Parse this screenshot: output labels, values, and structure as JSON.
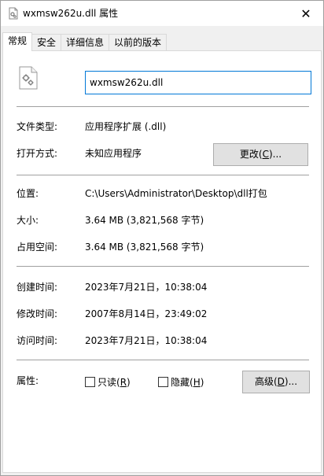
{
  "window": {
    "title": "wxmsw262u.dll 属性",
    "close_glyph": "✕"
  },
  "tabs": [
    {
      "label": "常规",
      "active": true
    },
    {
      "label": "安全",
      "active": false
    },
    {
      "label": "详细信息",
      "active": false
    },
    {
      "label": "以前的版本",
      "active": false
    }
  ],
  "file": {
    "icon": "dll-file-gear-icon",
    "name": "wxmsw262u.dll"
  },
  "general": {
    "type_label": "文件类型:",
    "type_value": "应用程序扩展 (.dll)",
    "opens_label": "打开方式:",
    "opens_value": "未知应用程序",
    "change_button": {
      "text": "更改(",
      "key": "C",
      "suffix": ")..."
    }
  },
  "location": {
    "location_label": "位置:",
    "location_value": "C:\\Users\\Administrator\\Desktop\\dll打包",
    "size_label": "大小:",
    "size_value": "3.64 MB (3,821,568 字节)",
    "disk_label": "占用空间:",
    "disk_value": "3.64 MB (3,821,568 字节)"
  },
  "times": {
    "created_label": "创建时间:",
    "created_value": "2023年7月21日，10:38:04",
    "modified_label": "修改时间:",
    "modified_value": "2007年8月14日，23:49:02",
    "accessed_label": "访问时间:",
    "accessed_value": "2023年7月21日，10:38:04"
  },
  "attributes": {
    "label": "属性:",
    "readonly": {
      "text": "只读(",
      "key": "R",
      "suffix": ")",
      "checked": false
    },
    "hidden": {
      "text": "隐藏(",
      "key": "H",
      "suffix": ")",
      "checked": false
    },
    "advanced_button": {
      "text": "高级(",
      "key": "D",
      "suffix": ")..."
    }
  },
  "colors": {
    "focus_border": "#0078d7",
    "button_bg": "#e1e1e1",
    "separator": "#a0a0a0"
  }
}
